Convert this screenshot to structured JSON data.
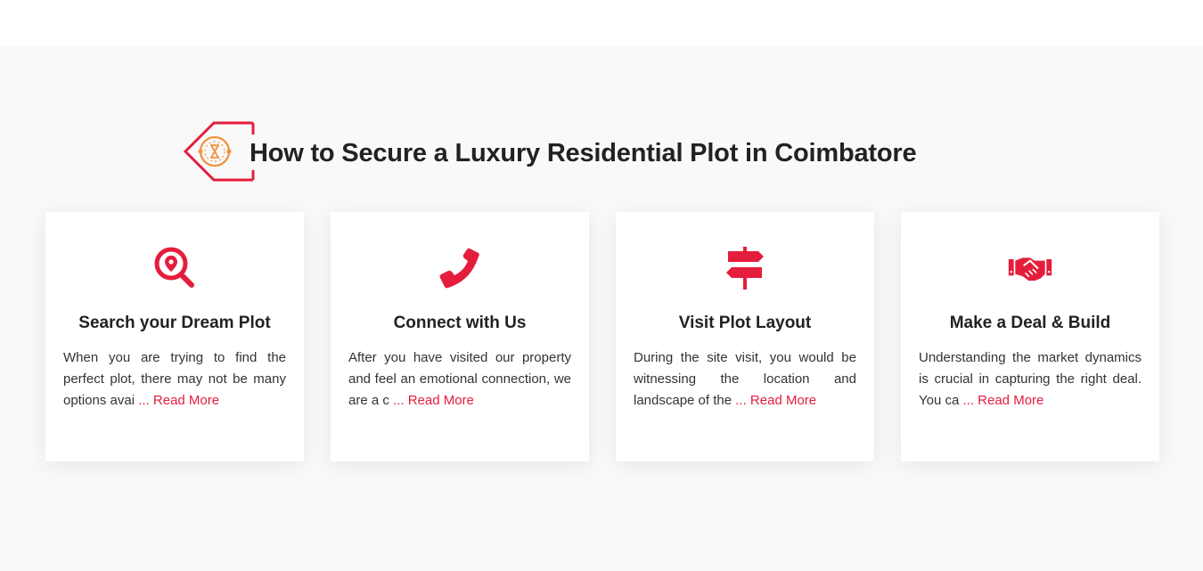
{
  "heading": {
    "title": "How to Secure a Luxury Residential Plot in Coimbatore"
  },
  "colors": {
    "accent": "#e51d3c",
    "logo_inner": "#f2913d",
    "section_bg": "#f9f9f9",
    "card_bg": "#ffffff"
  },
  "cards": [
    {
      "icon": "map-search-icon",
      "title": "Search your Dream Plot",
      "text": "When you are trying to find the perfect plot, there may not be many options avai",
      "read_more": "... Read More"
    },
    {
      "icon": "phone-icon",
      "title": "Connect with Us",
      "text": "After you have visited our property and feel an emotional connection, we are a c",
      "read_more": "... Read More"
    },
    {
      "icon": "signpost-icon",
      "title": "Visit Plot Layout",
      "text": "During the site visit, you would be witnessing the location and landscape of the",
      "read_more": "... Read More"
    },
    {
      "icon": "handshake-icon",
      "title": "Make a Deal & Build",
      "text": "Understanding the market dynamics is crucial in capturing the right deal. You ca",
      "read_more": "... Read More"
    }
  ]
}
